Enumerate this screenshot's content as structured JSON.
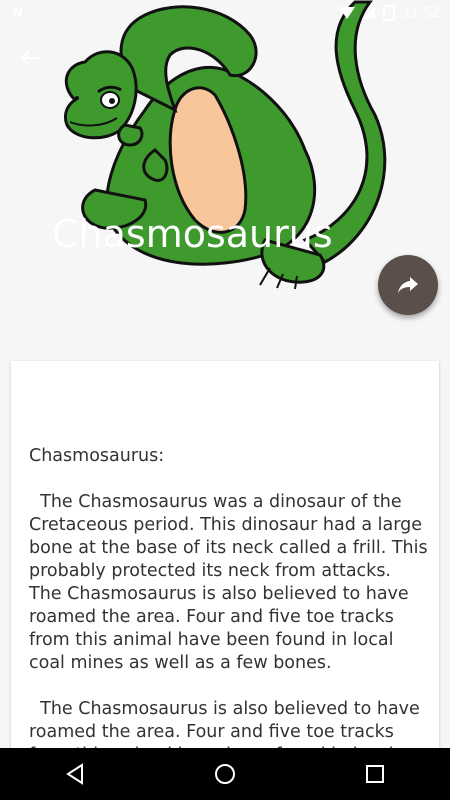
{
  "status_bar": {
    "carrier": "N",
    "time": "11:52"
  },
  "header": {
    "title": "Chasmosaurus",
    "back_icon": "arrow-left-icon",
    "share_icon": "share-arrow-icon",
    "colors": {
      "title": "#ffffff",
      "fab": "#5a4f4b",
      "dino_green": "#3f9a2e",
      "dino_belly": "#f7c79b"
    }
  },
  "content": {
    "body": "Chasmosaurus:\n\n  The Chasmosaurus was a dinosaur of the Cretaceous period. This dinosaur had a large bone at the base of its neck called a frill. This probably protected its neck from attacks.\nThe Chasmosaurus is also believed to have roamed the area. Four and five toe tracks from this animal have been found in local coal mines as well as a few bones.\n\n  The Chasmosaurus is also believed to have roamed the area. Four and five toe tracks from this animal have been found in local coal mines as well as a few bones."
  },
  "nav_bar": {
    "back_icon": "triangle-back-icon",
    "home_icon": "circle-home-icon",
    "recents_icon": "square-recents-icon"
  }
}
